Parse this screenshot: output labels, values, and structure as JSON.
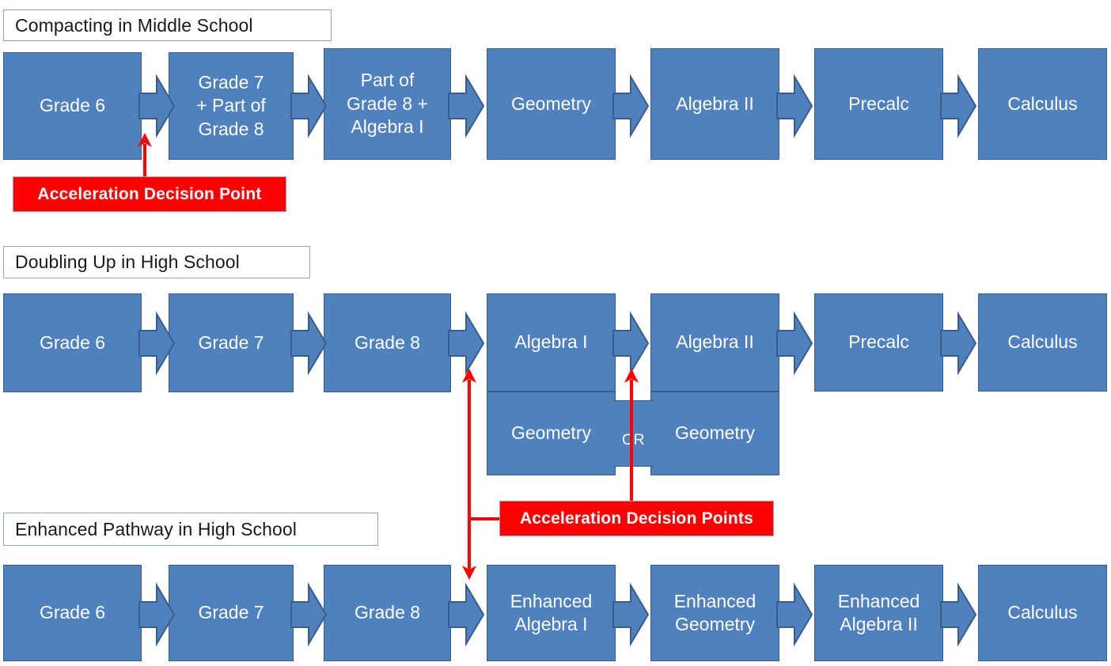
{
  "colors": {
    "box_fill": "#4E81BD",
    "box_border": "#385D8A",
    "accent_red": "#FF0000",
    "title_border": "#8CA7C6",
    "background": "#FFFFFF",
    "box_text": "#FFFFFF"
  },
  "sections": [
    {
      "id": "compacting",
      "title": "Compacting in Middle School",
      "steps": [
        {
          "lines": [
            "Grade 6"
          ]
        },
        {
          "lines": [
            "Grade 7",
            "+ Part of",
            "Grade 8"
          ]
        },
        {
          "lines": [
            "Part of",
            "Grade 8 +",
            "Algebra I"
          ]
        },
        {
          "lines": [
            "Geometry"
          ]
        },
        {
          "lines": [
            "Algebra II"
          ]
        },
        {
          "lines": [
            "Precalc"
          ]
        },
        {
          "lines": [
            "Calculus"
          ]
        }
      ]
    },
    {
      "id": "doubling-up",
      "title": "Doubling Up in High School",
      "steps": [
        {
          "lines": [
            "Grade 6"
          ]
        },
        {
          "lines": [
            "Grade 7"
          ]
        },
        {
          "lines": [
            "Grade 8"
          ]
        },
        {
          "lines": [
            "Algebra I"
          ]
        },
        {
          "lines": [
            "Algebra II"
          ]
        },
        {
          "lines": [
            "Precalc"
          ]
        },
        {
          "lines": [
            "Calculus"
          ]
        }
      ],
      "doubled": [
        {
          "lines": [
            "Geometry"
          ]
        },
        {
          "lines": [
            "Geometry"
          ]
        }
      ],
      "or_label": "OR"
    },
    {
      "id": "enhanced-pathway",
      "title": "Enhanced Pathway in High School",
      "steps": [
        {
          "lines": [
            "Grade 6"
          ]
        },
        {
          "lines": [
            "Grade 7"
          ]
        },
        {
          "lines": [
            "Grade 8"
          ]
        },
        {
          "lines": [
            "Enhanced",
            "Algebra I"
          ]
        },
        {
          "lines": [
            "Enhanced",
            "Geometry"
          ]
        },
        {
          "lines": [
            "Enhanced",
            "Algebra II"
          ]
        },
        {
          "lines": [
            "Calculus"
          ]
        }
      ]
    }
  ],
  "callouts": {
    "single": "Acceleration Decision Point",
    "multiple": "Acceleration Decision Points"
  }
}
